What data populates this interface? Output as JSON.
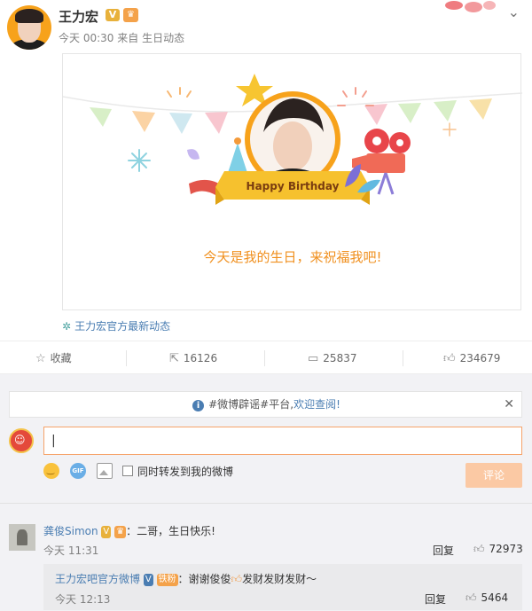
{
  "post": {
    "author": "王力宏",
    "time": "今天 00:30",
    "source_prefix": "来自",
    "source": "生日动态",
    "card": {
      "banner_text": "Happy Birthday",
      "caption": "今天是我的生日，来祝福我吧!"
    },
    "feed_link": "王力宏官方最新动态"
  },
  "actions": {
    "favorite": "收藏",
    "reposts": "16126",
    "comments": "25837",
    "likes": "234679"
  },
  "notice": {
    "prefix": "#微博辟谣#平台,",
    "link": "欢迎查阅!"
  },
  "composer": {
    "input_value": "|",
    "repost_label": "同时转发到我的微博",
    "submit_label": "评论"
  },
  "comments": [
    {
      "user": "龚俊Simon",
      "text": "：二哥，生日快乐!",
      "time": "今天 11:31",
      "reply_label": "回复",
      "likes": "72973",
      "replies": [
        {
          "user": "王力宏吧官方微博",
          "badge": "铁粉",
          "text": "：谢谢俊俊",
          "text_tail": "发财发财发财～",
          "time": "今天 12:13",
          "reply_label": "回复",
          "likes": "5464"
        }
      ]
    }
  ],
  "colors": {
    "accent_orange": "#f0901f",
    "link_blue": "#4a7db2",
    "verified_gold": "#e8b13b"
  }
}
